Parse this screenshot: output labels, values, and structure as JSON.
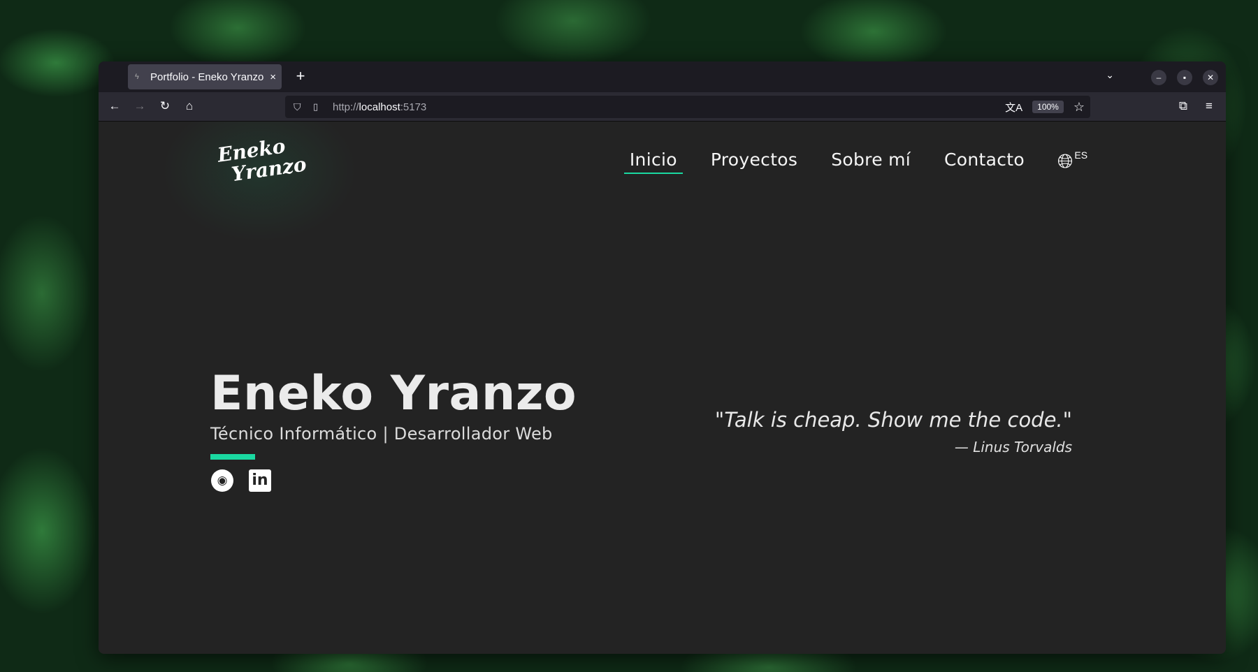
{
  "browser": {
    "tab": {
      "title": "Portfolio - Eneko Yranzo",
      "favicon": "loading-icon",
      "close": "×"
    },
    "new_tab": "+",
    "url": {
      "protocol": "http://",
      "host": "localhost",
      "port": ":5173"
    },
    "zoom": "100%"
  },
  "site": {
    "logo": {
      "line1": "Eneko",
      "line2": "Yranzo"
    },
    "nav": {
      "items": [
        {
          "label": "Inicio",
          "active": true
        },
        {
          "label": "Proyectos",
          "active": false
        },
        {
          "label": "Sobre mí",
          "active": false
        },
        {
          "label": "Contacto",
          "active": false
        }
      ]
    },
    "language": {
      "code": "ES"
    },
    "hero": {
      "name": "Eneko Yranzo",
      "subtitle": "Técnico Informático | Desarrollador Web"
    },
    "quote": {
      "text": "\"Talk is cheap. Show me the code.\"",
      "author": "— Linus Torvalds"
    },
    "colors": {
      "accent": "#1ad9a1",
      "background": "#232323"
    }
  }
}
